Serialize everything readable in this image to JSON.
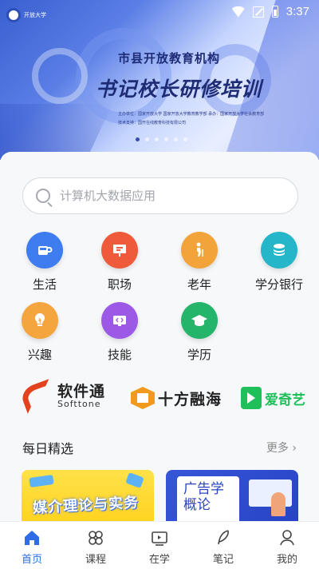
{
  "status": {
    "time": "3:37"
  },
  "banner": {
    "logo_text": "开放大学",
    "subtitle": "市县开放教育机构",
    "title": "书记校长研修培训",
    "line1": "主办单位：国家开放大学 国家开放大学教育教学部   承办：国家开放大学社会教育部",
    "line2": "技术支持：国开在线教育科技有限公司",
    "dots": 6,
    "active_dot": 0
  },
  "search": {
    "placeholder": "计算机大数据应用"
  },
  "categories": [
    {
      "label": "生活",
      "icon": "cup-icon",
      "color": "#3d7df0"
    },
    {
      "label": "职场",
      "icon": "presentation-icon",
      "color": "#ef5a3b"
    },
    {
      "label": "老年",
      "icon": "elderly-icon",
      "color": "#f2a43a"
    },
    {
      "label": "学分银行",
      "icon": "coin-stack-icon",
      "color": "#25b6c9"
    },
    {
      "label": "兴趣",
      "icon": "lightbulb-icon",
      "color": "#f5a53d"
    },
    {
      "label": "技能",
      "icon": "code-screen-icon",
      "color": "#9b59e6"
    },
    {
      "label": "学历",
      "icon": "graduation-cap-icon",
      "color": "#25b56a"
    }
  ],
  "partners": [
    {
      "name": "软件通",
      "sub": "Softtone"
    },
    {
      "name": "十方融海"
    },
    {
      "name": "爱奇艺"
    }
  ],
  "daily": {
    "title": "每日精选",
    "more": "更多 ›",
    "cards": [
      {
        "title": "媒介理论与实务"
      },
      {
        "title_line1": "广告学",
        "title_line2": "概论"
      }
    ]
  },
  "nav": [
    {
      "label": "首页",
      "icon": "home-icon",
      "active": true
    },
    {
      "label": "课程",
      "icon": "course-icon",
      "active": false
    },
    {
      "label": "在学",
      "icon": "studying-icon",
      "active": false
    },
    {
      "label": "笔记",
      "icon": "note-icon",
      "active": false
    },
    {
      "label": "我的",
      "icon": "profile-icon",
      "active": false
    }
  ],
  "colors": {
    "accent": "#2f6ce5"
  }
}
